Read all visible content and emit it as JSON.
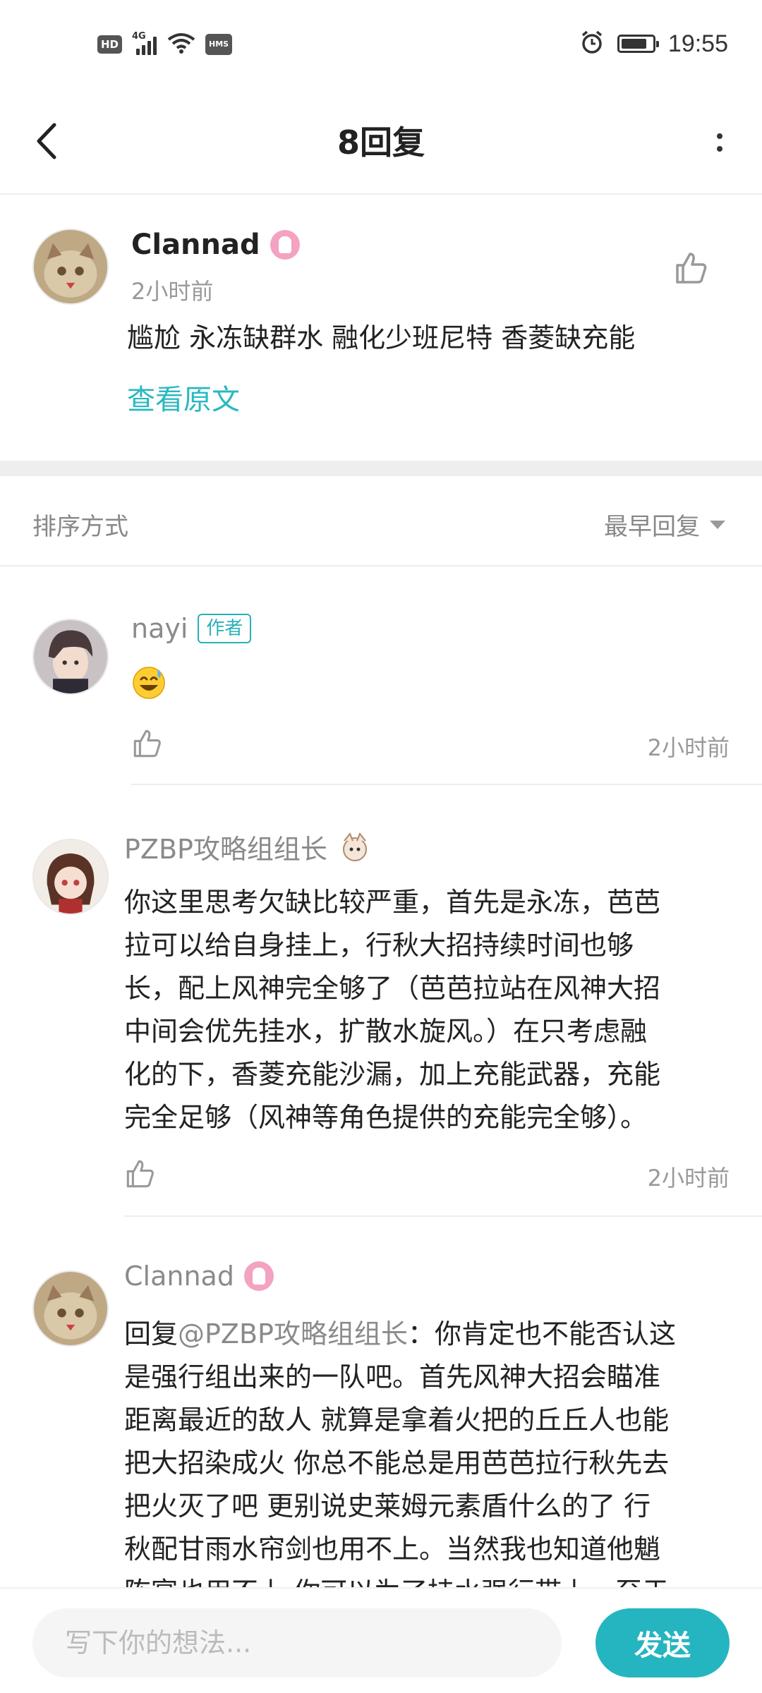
{
  "status_bar": {
    "hd": "HD",
    "network": "4G",
    "hms": "HMS",
    "time": "19:55",
    "battery_level": 0.85
  },
  "header": {
    "title": "8回复"
  },
  "original": {
    "user": "Clannad",
    "time": "2小时前",
    "text": "尴尬 永冻缺群水 融化少班尼特 香菱缺充能",
    "view_original": "查看原文"
  },
  "sort": {
    "label": "排序方式",
    "value": "最早回复"
  },
  "replies": [
    {
      "user": "nayi",
      "tag": "作者",
      "time": "2小时前"
    },
    {
      "user": "PZBP攻略组组长",
      "lines": [
        "你这里思考欠缺比较严重，首先是永冻，芭芭",
        "拉可以给自身挂上，行秋大招持续时间也够",
        "长，配上风神完全够了（芭芭拉站在风神大招",
        "中间会优先挂水，扩散水旋风。）在只考虑融",
        "化的下，香菱充能沙漏，加上充能武器，充能",
        "完全足够（风神等角色提供的充能完全够）。"
      ],
      "time": "2小时前"
    },
    {
      "user": "Clannad",
      "reply_prefix": "回复",
      "mention": "@PZBP攻略组组长",
      "first_line_rest": "：你肯定也不能否认这",
      "lines": [
        "是强行组出来的一队吧。首先风神大招会瞄准",
        "距离最近的敌人 就算是拿着火把的丘丘人也能",
        "把大招染成火 你总不能总是用芭芭拉行秋先去",
        "把火灭了吧 更别说史莱姆元素盾什么的了 行",
        "秋配甘雨水帘剑也用不上。当然我也知道他魈",
        "陈宴也用不上 你可以为了持水强行带上。至于"
      ]
    }
  ],
  "composer": {
    "placeholder": "写下你的想法...",
    "send_label": "发送"
  }
}
